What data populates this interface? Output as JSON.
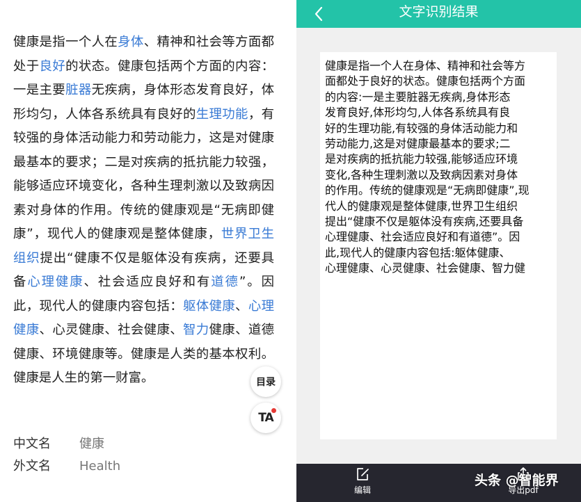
{
  "left": {
    "article": {
      "segments": [
        {
          "t": "健康是指一个人在",
          "link": false
        },
        {
          "t": "身体",
          "link": true
        },
        {
          "t": "、精神和社会等方面都处于",
          "link": false
        },
        {
          "t": "良好",
          "link": true
        },
        {
          "t": "的状态。健康包括两个方面的内容：一是主要",
          "link": false
        },
        {
          "t": "脏器",
          "link": true
        },
        {
          "t": "无疾病，身体形态发育良好，体形均匀，人体各系统具有良好的",
          "link": false
        },
        {
          "t": "生理功能",
          "link": true
        },
        {
          "t": "，有较强的身体活动能力和劳动能力，这是对健康最基本的要求；二是对疾病的抵抗能力较强，能够适应环境变化，各种生理刺激以及致病因素对身体的作用。传统的健康观是“无病即健康”，现代人的健康观是整体健康，",
          "link": false
        },
        {
          "t": "世界卫生组织",
          "link": true
        },
        {
          "t": "提出“健康不仅是躯体没有疾病，还要具备",
          "link": false
        },
        {
          "t": "心理健康",
          "link": true
        },
        {
          "t": "、社会适应良好和有",
          "link": false
        },
        {
          "t": "道德",
          "link": true
        },
        {
          "t": "”。因此，现代人的健康内容包括：",
          "link": false
        },
        {
          "t": "躯体健康",
          "link": true
        },
        {
          "t": "、",
          "link": false
        },
        {
          "t": "心理健康",
          "link": true
        },
        {
          "t": "、心灵健康、社会健康、",
          "link": false
        },
        {
          "t": "智力",
          "link": true
        },
        {
          "t": "健康、道德健康、环境健康等。健康是人类的基本权利。健康是人生的第一财富。",
          "link": false
        }
      ]
    },
    "infobox": [
      {
        "key": "中文名",
        "value": "健康"
      },
      {
        "key": "外文名",
        "value": "Health"
      }
    ],
    "toc_button_label": "目录",
    "ta_button_label": "TA"
  },
  "right": {
    "title": "文字识别结果",
    "result_text": "健康是指一个人在身体、精神和社会等方\n面都处于良好的状态。健康包括两个方面\n的内容:一是主要脏器无疾病,身体形态\n发育良好,体形均匀,人体各系统具有良\n好的生理功能,有较强的身体活动能力和\n劳动能力,这是对健康最基本的要求;二\n是对疾病的抵抗能力较强,能够适应环境\n变化,各种生理刺激以及致病因素对身体\n的作用。传统的健康观是“无病即健康”,现\n代人的健康观是整体健康,世界卫生组织\n提出“健康不仅是躯体没有疾病,还要具备\n心理健康、社会适应良好和有道德”。因\n此,现代人的健康内容包括:躯体健康、\n心理健康、心灵健康、社会健康、智力健",
    "bottombar": {
      "edit_label": "编辑",
      "export_label": "导出pdf"
    },
    "watermark": "头条 @智能界"
  },
  "colors": {
    "accent": "#23c3a8",
    "link": "#3a7bd5",
    "bottombar": "#26262f"
  },
  "icons": [
    "back-arrow-icon",
    "edit-icon",
    "export-icon"
  ]
}
